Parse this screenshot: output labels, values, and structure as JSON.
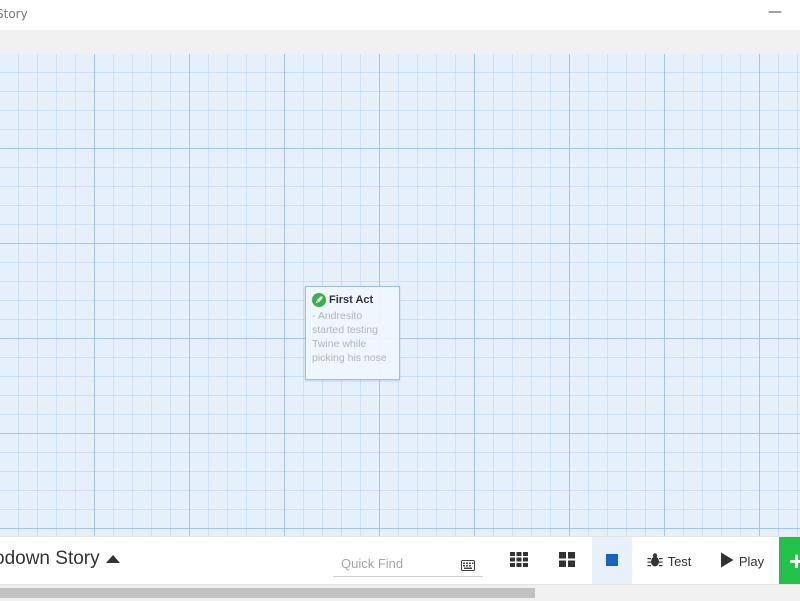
{
  "window": {
    "title": "Story",
    "minimize_glyph": "—"
  },
  "passage": {
    "title": "First Act",
    "excerpt": "- Andresito started testing Twine while picking his nose",
    "icon": "rocket-icon",
    "icon_color": "#3cb04a"
  },
  "toolbar": {
    "story_name": "odown Story",
    "story_caret": "▲",
    "quick_find_placeholder": "Quick Find",
    "test_label": "Test",
    "play_label": "Play",
    "add_glyph": "+"
  },
  "colors": {
    "canvas_bg": "#e5f0fb",
    "accent_green": "#22c14a",
    "accent_blue": "#1565c0"
  },
  "icons": {
    "story_details": "keyboard-icon",
    "zoom_1": "grid-3x3-icon",
    "zoom_2": "grid-2x2-icon",
    "zoom_3": "square-icon",
    "test": "bug-icon",
    "play": "play-icon",
    "add": "plus-icon"
  }
}
